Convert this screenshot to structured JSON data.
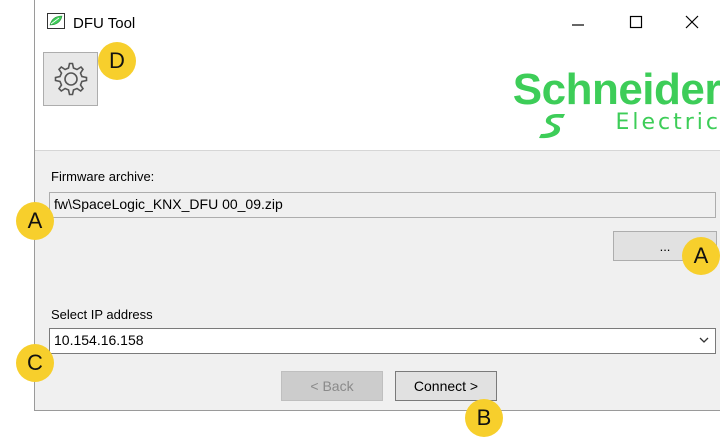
{
  "window": {
    "title": "DFU Tool",
    "controls": {
      "minimize": "—",
      "maximize": "☐",
      "close": "✕"
    }
  },
  "toolbar": {
    "settings_icon": "gear-icon"
  },
  "brand": {
    "name": "Schneider",
    "sub": "Electric",
    "color": "#3dcd58"
  },
  "firmware": {
    "label": "Firmware archive:",
    "value": "fw\\SpaceLogic_KNX_DFU 00_09.zip",
    "browse_label": "..."
  },
  "ip": {
    "label": "Select  IP address",
    "selected": "10.154.16.158"
  },
  "footer": {
    "back_label": "< Back",
    "connect_label": "Connect >"
  },
  "callouts": {
    "a": "A",
    "b": "B",
    "c": "C",
    "d": "D",
    "accent": "#f7cf2c"
  }
}
